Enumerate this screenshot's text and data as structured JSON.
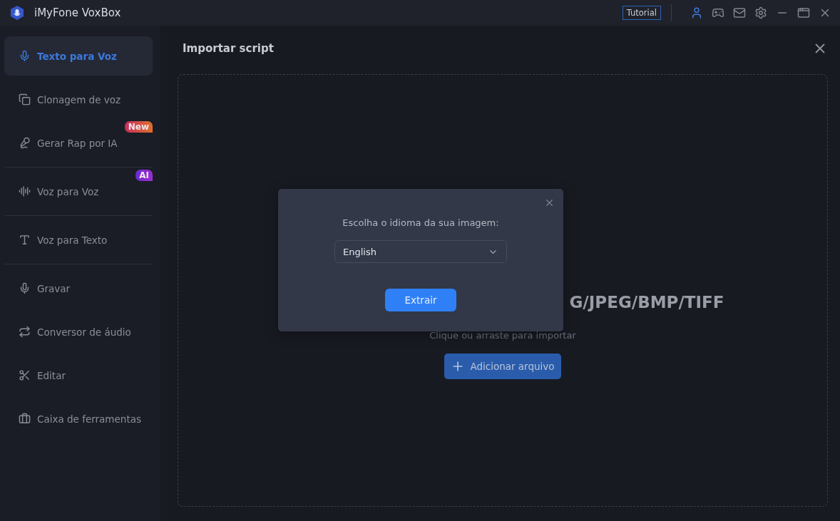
{
  "window": {
    "title": "iMyFone VoxBox",
    "tutorial": "Tutorial"
  },
  "sidebar": {
    "groups": [
      [
        {
          "label": "Texto para Voz",
          "selected": true
        },
        {
          "label": "Clonagem de voz",
          "selected": false
        },
        {
          "label": "Gerar Rap por IA",
          "selected": false,
          "badge": {
            "text": "New",
            "kind": "new"
          }
        }
      ],
      [
        {
          "label": "Voz para Voz",
          "selected": false,
          "badge": {
            "text": "AI",
            "kind": "ai"
          }
        }
      ],
      [
        {
          "label": "Voz para Texto",
          "selected": false
        }
      ],
      [
        {
          "label": "Gravar",
          "selected": false
        },
        {
          "label": "Conversor de áudio",
          "selected": false
        },
        {
          "label": "Editar",
          "selected": false
        },
        {
          "label": "Caixa de ferramentas",
          "selected": false
        }
      ]
    ]
  },
  "panel": {
    "title": "Importar script",
    "dropzone": {
      "formats": "G/JPEG/BMP/TIFF",
      "hint": "Clique ou arraste para importar",
      "button": "Adicionar arquivo"
    }
  },
  "dialog": {
    "prompt": "Escolha o idioma da sua imagem:",
    "language": "English",
    "button": "Extrair"
  }
}
